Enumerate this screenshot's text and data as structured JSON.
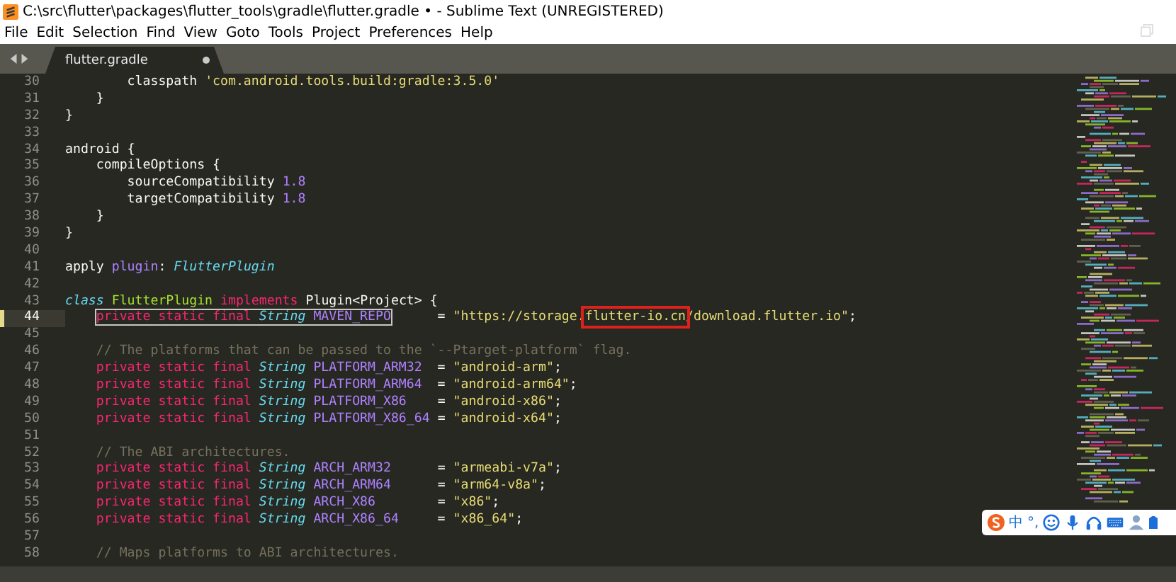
{
  "window": {
    "title": "C:\\src\\flutter\\packages\\flutter_tools\\gradle\\flutter.gradle • - Sublime Text (UNREGISTERED)"
  },
  "menu": [
    "File",
    "Edit",
    "Selection",
    "Find",
    "View",
    "Goto",
    "Tools",
    "Project",
    "Preferences",
    "Help"
  ],
  "tabs": [
    {
      "label": "flutter.gradle",
      "selected": true,
      "modified": true
    }
  ],
  "editor": {
    "lines": [
      {
        "number": "30",
        "current": false,
        "tokens": [
          {
            "kind": "plain",
            "text": "        classpath "
          },
          {
            "kind": "string",
            "text": "'com.android.tools.build:gradle:3.5.0'"
          }
        ]
      },
      {
        "number": "31",
        "current": false,
        "tokens": [
          {
            "kind": "plain",
            "text": "    }"
          }
        ]
      },
      {
        "number": "32",
        "current": false,
        "tokens": [
          {
            "kind": "plain",
            "text": "}"
          }
        ]
      },
      {
        "number": "33",
        "current": false
      },
      {
        "number": "34",
        "current": false,
        "tokens": [
          {
            "kind": "plain",
            "text": "android {"
          }
        ]
      },
      {
        "number": "35",
        "current": false,
        "tokens": [
          {
            "kind": "plain",
            "text": "    compileOptions {"
          }
        ]
      },
      {
        "number": "36",
        "current": false,
        "tokens": [
          {
            "kind": "plain",
            "text": "        sourceCompatibility "
          },
          {
            "kind": "constant",
            "text": "1.8"
          }
        ]
      },
      {
        "number": "37",
        "current": false,
        "tokens": [
          {
            "kind": "plain",
            "text": "        targetCompatibility "
          },
          {
            "kind": "constant",
            "text": "1.8"
          }
        ]
      },
      {
        "number": "38",
        "current": false,
        "tokens": [
          {
            "kind": "plain",
            "text": "    }"
          }
        ]
      },
      {
        "number": "39",
        "current": false,
        "tokens": [
          {
            "kind": "plain",
            "text": "}"
          }
        ]
      },
      {
        "number": "40",
        "current": false
      },
      {
        "number": "41",
        "current": false,
        "tokens": [
          {
            "kind": "plain",
            "text": "apply "
          },
          {
            "kind": "constant",
            "text": "plugin"
          },
          {
            "kind": "plain",
            "text": ": "
          },
          {
            "kind": "type",
            "text": "FlutterPlugin"
          }
        ]
      },
      {
        "number": "42",
        "current": false
      },
      {
        "number": "43",
        "current": false,
        "tokens": [
          {
            "kind": "type",
            "text": "class"
          },
          {
            "kind": "entity",
            "text": " FlutterPlugin"
          },
          {
            "kind": "keyword",
            "text": " implements"
          },
          {
            "kind": "plain",
            "text": " Plugin<Project> {"
          }
        ]
      },
      {
        "number": "44",
        "current": true,
        "tokens": [
          {
            "kind": "selection",
            "tokens": [
              {
                "kind": "keyword",
                "text": "private static final"
              },
              {
                "kind": "type",
                "text": " String"
              },
              {
                "kind": "constant",
                "text": " MAVEN_REPO"
              }
            ]
          },
          {
            "kind": "plain",
            "text": "      = "
          },
          {
            "kind": "string",
            "text": "\"https://storage."
          },
          {
            "kind": "annotation",
            "tokens": [
              {
                "kind": "string",
                "text": "flutter-io.cn"
              }
            ]
          },
          {
            "kind": "string",
            "text": "/download.flutter.io\""
          },
          {
            "kind": "plain",
            "text": ";"
          }
        ]
      },
      {
        "number": "45",
        "current": false
      },
      {
        "number": "46",
        "current": false,
        "tokens": [
          {
            "kind": "comment",
            "text": "    // The platforms that can be passed to the `--Ptarget-platform` flag."
          }
        ]
      },
      {
        "number": "47",
        "current": false,
        "tokens": [
          {
            "kind": "keyword",
            "text": "    private static final"
          },
          {
            "kind": "type",
            "text": " String"
          },
          {
            "kind": "constant",
            "text": " PLATFORM_ARM32"
          },
          {
            "kind": "plain",
            "text": "  = "
          },
          {
            "kind": "string",
            "text": "\"android-arm\""
          },
          {
            "kind": "plain",
            "text": ";"
          }
        ]
      },
      {
        "number": "48",
        "current": false,
        "tokens": [
          {
            "kind": "keyword",
            "text": "    private static final"
          },
          {
            "kind": "type",
            "text": " String"
          },
          {
            "kind": "constant",
            "text": " PLATFORM_ARM64"
          },
          {
            "kind": "plain",
            "text": "  = "
          },
          {
            "kind": "string",
            "text": "\"android-arm64\""
          },
          {
            "kind": "plain",
            "text": ";"
          }
        ]
      },
      {
        "number": "49",
        "current": false,
        "tokens": [
          {
            "kind": "keyword",
            "text": "    private static final"
          },
          {
            "kind": "type",
            "text": " String"
          },
          {
            "kind": "constant",
            "text": " PLATFORM_X86"
          },
          {
            "kind": "plain",
            "text": "    = "
          },
          {
            "kind": "string",
            "text": "\"android-x86\""
          },
          {
            "kind": "plain",
            "text": ";"
          }
        ]
      },
      {
        "number": "50",
        "current": false,
        "tokens": [
          {
            "kind": "keyword",
            "text": "    private static final"
          },
          {
            "kind": "type",
            "text": " String"
          },
          {
            "kind": "constant",
            "text": " PLATFORM_X86_64"
          },
          {
            "kind": "plain",
            "text": " = "
          },
          {
            "kind": "string",
            "text": "\"android-x64\""
          },
          {
            "kind": "plain",
            "text": ";"
          }
        ]
      },
      {
        "number": "51",
        "current": false
      },
      {
        "number": "52",
        "current": false,
        "tokens": [
          {
            "kind": "comment",
            "text": "    // The ABI architectures."
          }
        ]
      },
      {
        "number": "53",
        "current": false,
        "tokens": [
          {
            "kind": "keyword",
            "text": "    private static final"
          },
          {
            "kind": "type",
            "text": " String"
          },
          {
            "kind": "constant",
            "text": " ARCH_ARM32"
          },
          {
            "kind": "plain",
            "text": "      = "
          },
          {
            "kind": "string",
            "text": "\"armeabi-v7a\""
          },
          {
            "kind": "plain",
            "text": ";"
          }
        ]
      },
      {
        "number": "54",
        "current": false,
        "tokens": [
          {
            "kind": "keyword",
            "text": "    private static final"
          },
          {
            "kind": "type",
            "text": " String"
          },
          {
            "kind": "constant",
            "text": " ARCH_ARM64"
          },
          {
            "kind": "plain",
            "text": "      = "
          },
          {
            "kind": "string",
            "text": "\"arm64-v8a\""
          },
          {
            "kind": "plain",
            "text": ";"
          }
        ]
      },
      {
        "number": "55",
        "current": false,
        "tokens": [
          {
            "kind": "keyword",
            "text": "    private static final"
          },
          {
            "kind": "type",
            "text": " String"
          },
          {
            "kind": "constant",
            "text": " ARCH_X86"
          },
          {
            "kind": "plain",
            "text": "        = "
          },
          {
            "kind": "string",
            "text": "\"x86\""
          },
          {
            "kind": "plain",
            "text": ";"
          }
        ]
      },
      {
        "number": "56",
        "current": false,
        "tokens": [
          {
            "kind": "keyword",
            "text": "    private static final"
          },
          {
            "kind": "type",
            "text": " String"
          },
          {
            "kind": "constant",
            "text": " ARCH_X86_64"
          },
          {
            "kind": "plain",
            "text": "     = "
          },
          {
            "kind": "string",
            "text": "\"x86_64\""
          },
          {
            "kind": "plain",
            "text": ";"
          }
        ]
      },
      {
        "number": "57",
        "current": false
      },
      {
        "number": "58",
        "current": false,
        "tokens": [
          {
            "kind": "comment",
            "text": "    // Maps platforms to ABI architectures."
          }
        ]
      }
    ]
  },
  "ime_toolbar": {
    "mode": "中",
    "punctuation": "°,"
  }
}
